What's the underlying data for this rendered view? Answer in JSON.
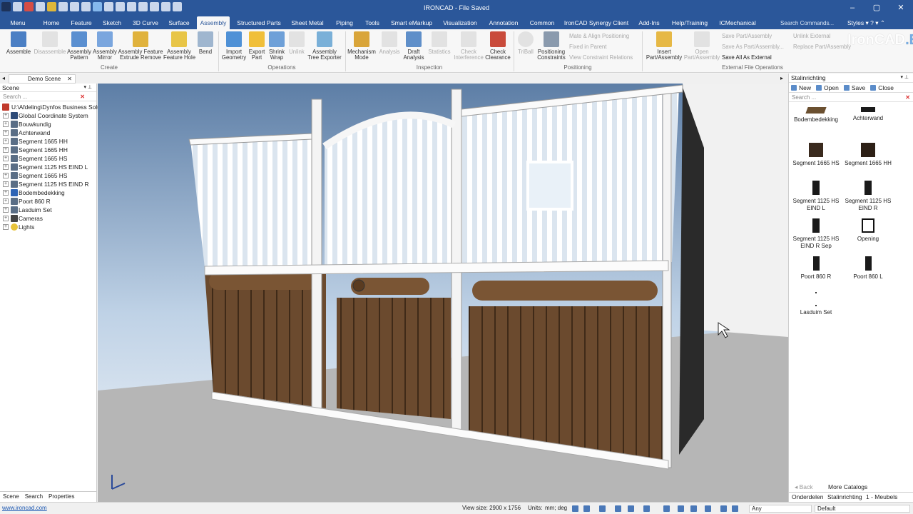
{
  "window": {
    "title": "IRONCAD - File Saved",
    "minimize": "–",
    "maximize": "▢",
    "close": "✕"
  },
  "tabs": [
    {
      "label": "Menu"
    },
    {
      "label": "Home"
    },
    {
      "label": "Feature"
    },
    {
      "label": "Sketch"
    },
    {
      "label": "3D Curve"
    },
    {
      "label": "Surface"
    },
    {
      "label": "Assembly"
    },
    {
      "label": "Structured Parts"
    },
    {
      "label": "Sheet Metal"
    },
    {
      "label": "Piping"
    },
    {
      "label": "Tools"
    },
    {
      "label": "Smart eMarkup"
    },
    {
      "label": "Visualization"
    },
    {
      "label": "Annotation"
    },
    {
      "label": "Common"
    },
    {
      "label": "IronCAD Synergy Client"
    },
    {
      "label": "Add-Ins"
    },
    {
      "label": "Help/Training"
    },
    {
      "label": "ICMechanical"
    }
  ],
  "command_search": "Search Commands...",
  "styles_label": "Styles",
  "brand": {
    "name": "IronCAD",
    "suffix": ".EU"
  },
  "ribbon": {
    "create": {
      "label": "Create",
      "buttons": [
        "Assemble",
        "Disassemble",
        "Assembly\nPattern",
        "Assembly\nMirror",
        "Assembly Feature\nExtrude Remove",
        "Assembly\nFeature Hole",
        "Bend"
      ]
    },
    "operations": {
      "label": "Operations",
      "buttons": [
        "Import\nGeometry",
        "Export\nPart",
        "Shrink\nWrap",
        "Unlink",
        "Assembly\nTree Exporter"
      ]
    },
    "inspection": {
      "label": "Inspection",
      "buttons": [
        "Mechanism\nMode",
        "Analysis",
        "Draft\nAnalysis",
        "Statistics",
        "Check\nInterference",
        "Check\nClearance"
      ]
    },
    "positioning": {
      "label": "Positioning",
      "buttons": [
        "TriBall",
        "Positioning\nConstraints"
      ],
      "small": [
        "Mate & Align Positioning",
        "Fixed in Parent",
        "View Constraint Relations"
      ]
    },
    "external": {
      "label": "External File Operations",
      "buttons": [
        "Insert\nPart/Assembly",
        "Open\nPart/Assembly"
      ],
      "small": [
        "Save Part/Assembly",
        "Save As Part/Assembly...",
        "Save All As External",
        "Unlink  External",
        "Replace Part/Assembly"
      ]
    }
  },
  "document_tab": "Demo Scene",
  "scene": {
    "header": "Scene",
    "search_placeholder": "Search ...",
    "items": [
      {
        "label": "U:\\Afdeling\\Dynfos Business Solu"
      },
      {
        "label": "Global Coordinate System"
      },
      {
        "label": "Bouwkundig"
      },
      {
        "label": "Achterwand"
      },
      {
        "label": "Segment 1665 HH"
      },
      {
        "label": "Segment 1665 HH"
      },
      {
        "label": "Segment 1665 HS"
      },
      {
        "label": "Segment 1125 HS EIND L"
      },
      {
        "label": "Segment 1665 HS"
      },
      {
        "label": "Segment 1125 HS EIND R"
      },
      {
        "label": "Bodembedekking"
      },
      {
        "label": "Poort 860 R"
      },
      {
        "label": "Lasduim Set"
      },
      {
        "label": "Cameras"
      },
      {
        "label": "Lights"
      }
    ],
    "bottom_tabs": [
      "Scene",
      "Search",
      "Properties"
    ]
  },
  "catalog": {
    "header": "Stalinrichting",
    "toolbar": [
      "New",
      "Open",
      "Save",
      "Close"
    ],
    "search_placeholder": "Search ...",
    "items": [
      {
        "label": "Bodembedekking"
      },
      {
        "label": "Achterwand"
      },
      {
        "label": "Segment 1665 HS"
      },
      {
        "label": "Segment 1665 HH"
      },
      {
        "label": "Segment 1125 HS\nEIND L"
      },
      {
        "label": "Segment 1125 HS\nEIND R"
      },
      {
        "label": "Segment 1125 HS\nEIND R Sep"
      },
      {
        "label": "Opening"
      },
      {
        "label": "Poort 860 R"
      },
      {
        "label": "Poort 860 L"
      },
      {
        "label": "Lasduim Set"
      }
    ],
    "back": "Back",
    "more": "More Catalogs",
    "bottom_tabs": [
      "Onderdelen",
      "Stalinrichting",
      "1 - Meubels"
    ]
  },
  "status": {
    "link": "www.ironcad.com",
    "view_size": "View size: 2900 x 1756",
    "units_label": "Units:",
    "units_value": "mm; deg",
    "filter": "Any",
    "style": "Default"
  },
  "colors": {
    "accent": "#2b579a",
    "wood": "#6b4a2e",
    "frame": "#f4f4f4"
  }
}
